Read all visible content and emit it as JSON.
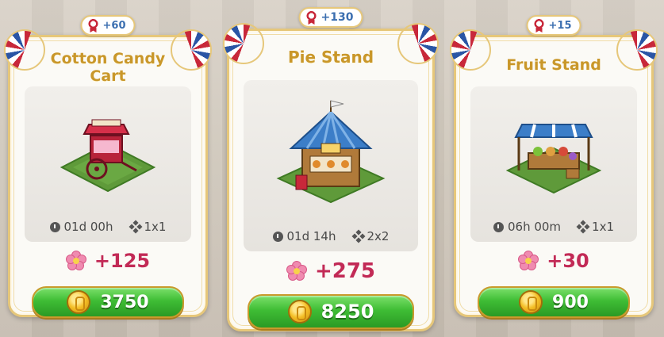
{
  "cards": [
    {
      "title": "Cotton Candy Cart",
      "xp": "+60",
      "time": "01d 00h",
      "size": "1x1",
      "reward": "+125",
      "price": "3750",
      "icons": {
        "xp": "ribbon-icon",
        "time": "clock-icon",
        "size": "grid-icon",
        "reward": "flower-icon",
        "price": "coin-icon"
      }
    },
    {
      "title": "Pie Stand",
      "xp": "+130",
      "time": "01d 14h",
      "size": "2x2",
      "reward": "+275",
      "price": "8250",
      "icons": {
        "xp": "ribbon-icon",
        "time": "clock-icon",
        "size": "grid-icon",
        "reward": "flower-icon",
        "price": "coin-icon"
      }
    },
    {
      "title": "Fruit Stand",
      "xp": "+15",
      "time": "06h 00m",
      "size": "1x1",
      "reward": "+30",
      "price": "900",
      "icons": {
        "xp": "ribbon-icon",
        "time": "clock-icon",
        "size": "grid-icon",
        "reward": "flower-icon",
        "price": "coin-icon"
      }
    }
  ],
  "colors": {
    "title": "#c9972a",
    "xp": "#3c6fb0",
    "reward": "#c22a56",
    "button_green": "#3fbd35",
    "card_border": "#e6c77a"
  }
}
